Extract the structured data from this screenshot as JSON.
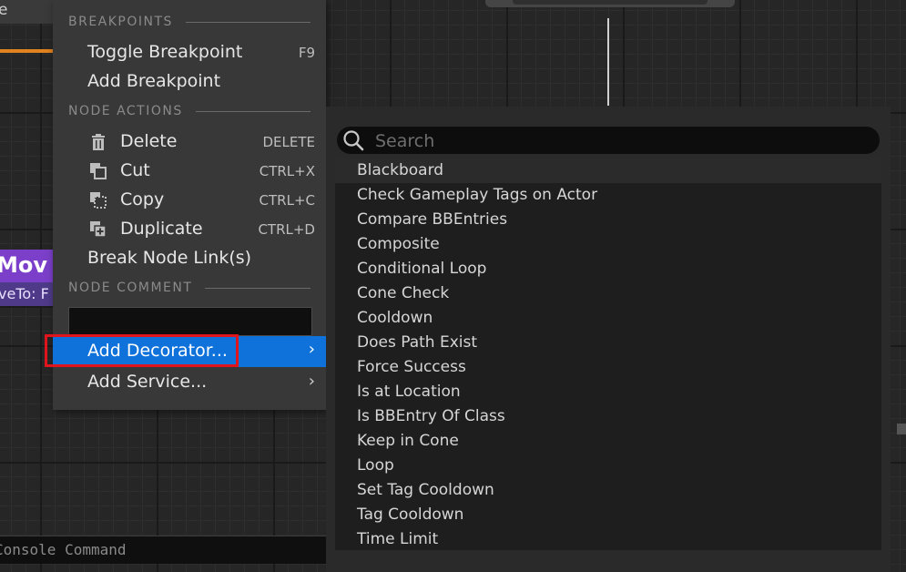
{
  "background": {
    "top_left_tab_text": "e",
    "node_title": "Mov",
    "node_subtitle": "veTo: F",
    "console_placeholder": "Console Command"
  },
  "menu": {
    "sections": {
      "breakpoints": "BREAKPOINTS",
      "node_actions": "NODE ACTIONS",
      "node_comment": "NODE COMMENT"
    },
    "toggle_breakpoint": {
      "label": "Toggle Breakpoint",
      "shortcut": "F9"
    },
    "add_breakpoint": {
      "label": "Add Breakpoint"
    },
    "delete": {
      "label": "Delete",
      "shortcut": "DELETE",
      "icon": "trash-icon"
    },
    "cut": {
      "label": "Cut",
      "shortcut": "CTRL+X",
      "icon": "cut-icon"
    },
    "copy": {
      "label": "Copy",
      "shortcut": "CTRL+C",
      "icon": "copy-icon"
    },
    "duplicate": {
      "label": "Duplicate",
      "shortcut": "CTRL+D",
      "icon": "duplicate-icon"
    },
    "break_links": {
      "label": "Break Node Link(s)"
    },
    "comment_value": "",
    "add_decorator": {
      "label": "Add Decorator...",
      "arrow": "›"
    },
    "add_service": {
      "label": "Add Service...",
      "arrow": "›"
    }
  },
  "submenu": {
    "search_placeholder": "Search",
    "items": [
      "Blackboard",
      "Check Gameplay Tags on Actor",
      "Compare BBEntries",
      "Composite",
      "Conditional Loop",
      "Cone Check",
      "Cooldown",
      "Does Path Exist",
      "Force Success",
      "Is at Location",
      "Is BBEntry Of Class",
      "Keep in Cone",
      "Loop",
      "Set Tag Cooldown",
      "Tag Cooldown",
      "Time Limit"
    ]
  },
  "colors": {
    "highlight": "#0e72da",
    "selection_frame": "#e0141c",
    "node_purple": "#7b3fc9",
    "wire_orange": "#e0821d"
  }
}
